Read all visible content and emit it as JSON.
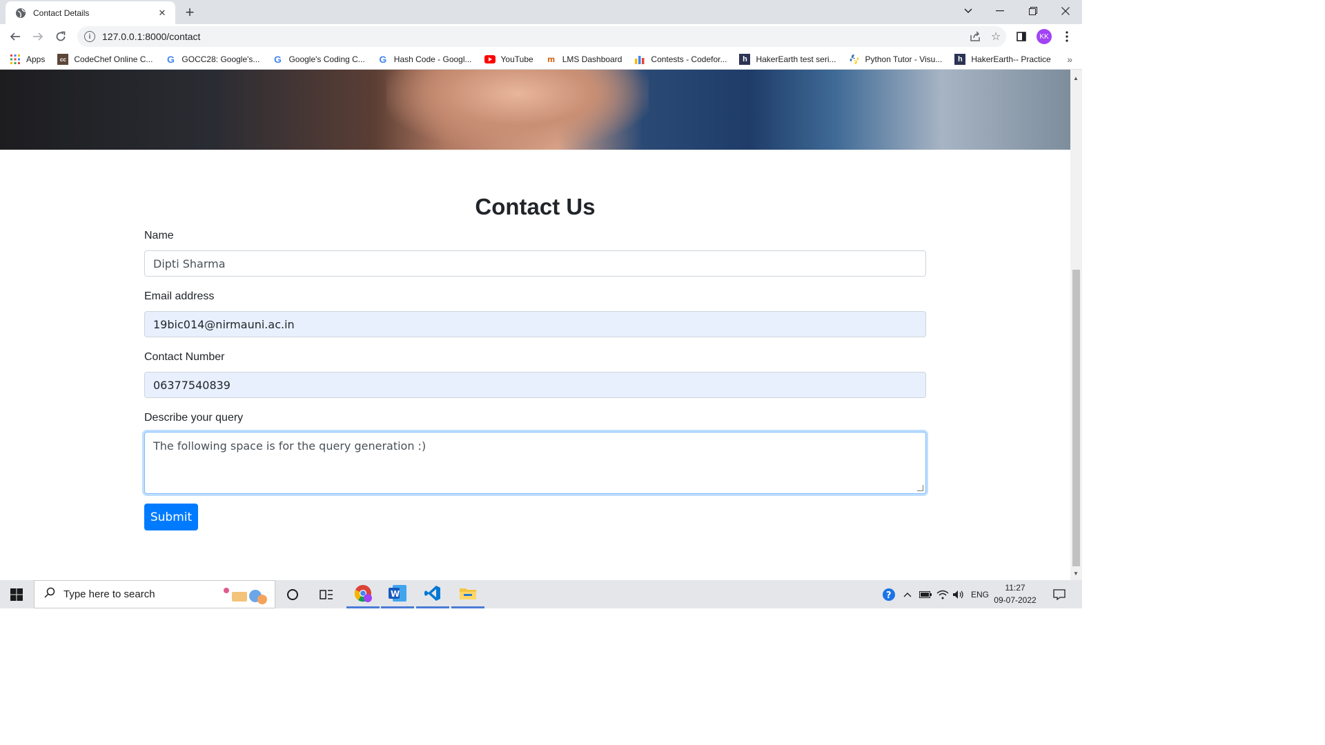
{
  "browser": {
    "tab_title": "Contact Details",
    "url": "127.0.0.1:8000/contact",
    "avatar_initials": "KK",
    "bookmarks": [
      {
        "label": "Apps",
        "icon": "apps-grid-icon"
      },
      {
        "label": "CodeChef Online C...",
        "icon": "codechef-icon"
      },
      {
        "label": "GOCC28: Google's...",
        "icon": "google-icon"
      },
      {
        "label": "Google's Coding C...",
        "icon": "google-icon"
      },
      {
        "label": "Hash Code - Googl...",
        "icon": "google-icon"
      },
      {
        "label": "YouTube",
        "icon": "youtube-icon"
      },
      {
        "label": "LMS Dashboard",
        "icon": "lms-icon"
      },
      {
        "label": "Contests - Codefor...",
        "icon": "codeforces-icon"
      },
      {
        "label": "HakerEarth test seri...",
        "icon": "hackerearth-icon"
      },
      {
        "label": "Python Tutor - Visu...",
        "icon": "python-icon"
      },
      {
        "label": "HakerEarth-- Practice",
        "icon": "hackerearth-icon"
      }
    ],
    "more_bookmarks": "»"
  },
  "page": {
    "title": "Contact Us",
    "name_label": "Name",
    "name_value": "Dipti Sharma",
    "email_label": "Email address",
    "email_value": "19bic014@nirmauni.ac.in",
    "contact_label": "Contact Number",
    "contact_value": "06377540839",
    "query_label": "Describe your query",
    "query_value": "The following space is for the query generation :)",
    "submit_label": "Submit"
  },
  "taskbar": {
    "search_placeholder": "Type here to search",
    "language": "ENG",
    "time": "11:27",
    "date": "09-07-2022"
  },
  "colors": {
    "primary_button": "#007bff",
    "autofill_bg": "#e8f0fe",
    "focus_border": "#80bdff",
    "avatar": "#a142f4"
  }
}
